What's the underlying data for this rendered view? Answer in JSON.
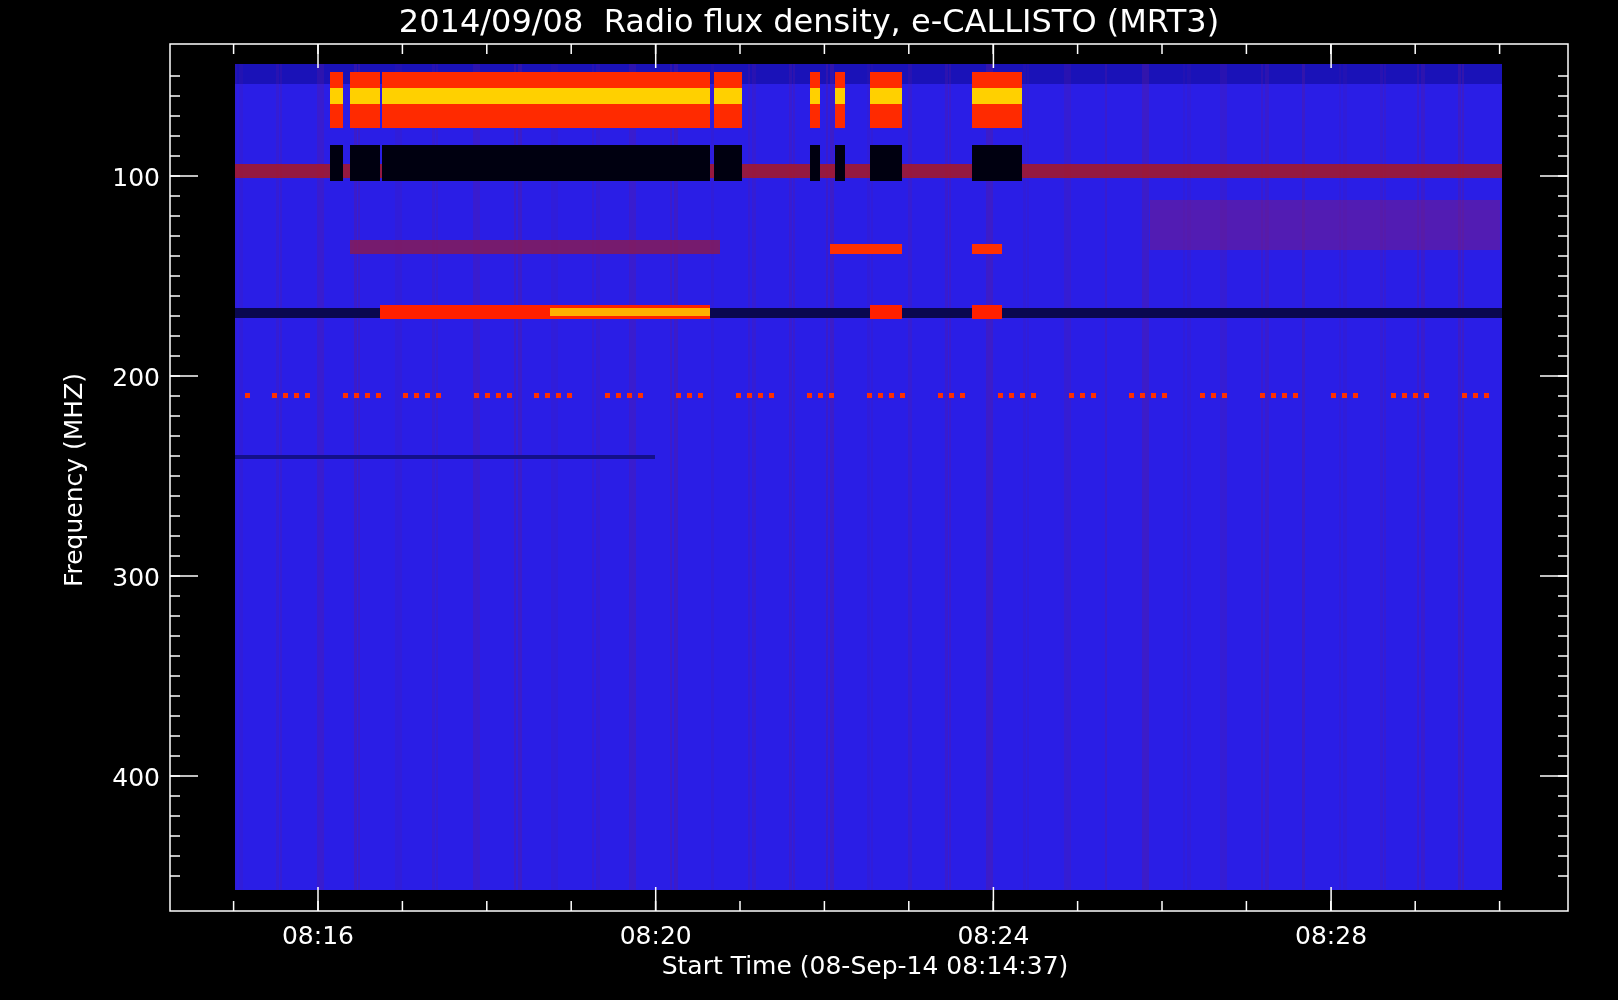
{
  "title": "2014/09/08  Radio flux density, e-CALLISTO (MRT3)",
  "y_axis": {
    "label": "Frequency (MHZ)",
    "ticks": [
      "100",
      "200",
      "300",
      "400"
    ]
  },
  "x_axis": {
    "label": "Start Time (08-Sep-14 08:14:37)",
    "ticks": [
      "08:16",
      "08:20",
      "08:24",
      "08:28"
    ]
  }
}
